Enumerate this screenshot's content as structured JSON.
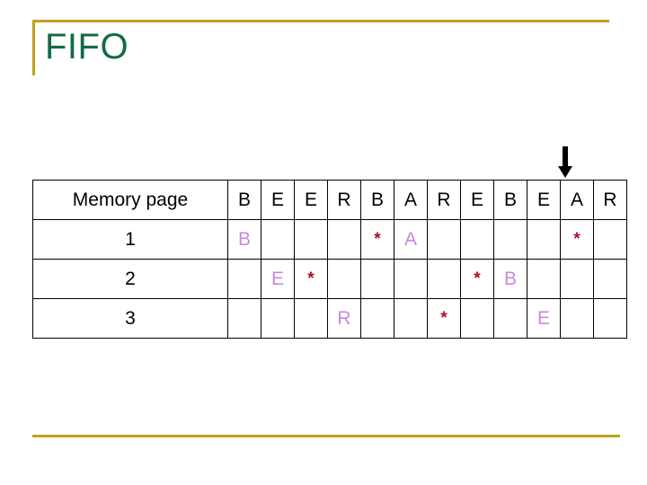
{
  "slide": {
    "title": "FIFO",
    "title_color": "#136b40",
    "accent_color": "#bfa01f"
  },
  "pointer": {
    "name": "down-arrow",
    "points_at_column_index": 10,
    "points_at_reference": "A"
  },
  "table": {
    "header_label": "Memory page",
    "reference_string": [
      "B",
      "E",
      "E",
      "R",
      "B",
      "A",
      "R",
      "E",
      "B",
      "E",
      "A",
      "R"
    ],
    "column_count": 12,
    "letter_color": "#c888dd",
    "fault_color": "#a81228",
    "fault_symbol": "*",
    "rows": [
      {
        "label": "1",
        "cells": [
          "B",
          "",
          "",
          "",
          "*",
          "A",
          "",
          "",
          "",
          "",
          "*",
          ""
        ]
      },
      {
        "label": "2",
        "cells": [
          "",
          "E",
          "*",
          "",
          "",
          "",
          "",
          "*",
          "B",
          "",
          "",
          ""
        ]
      },
      {
        "label": "3",
        "cells": [
          "",
          "",
          "",
          "R",
          "",
          "",
          "*",
          "",
          "",
          "E",
          "",
          ""
        ]
      }
    ]
  }
}
